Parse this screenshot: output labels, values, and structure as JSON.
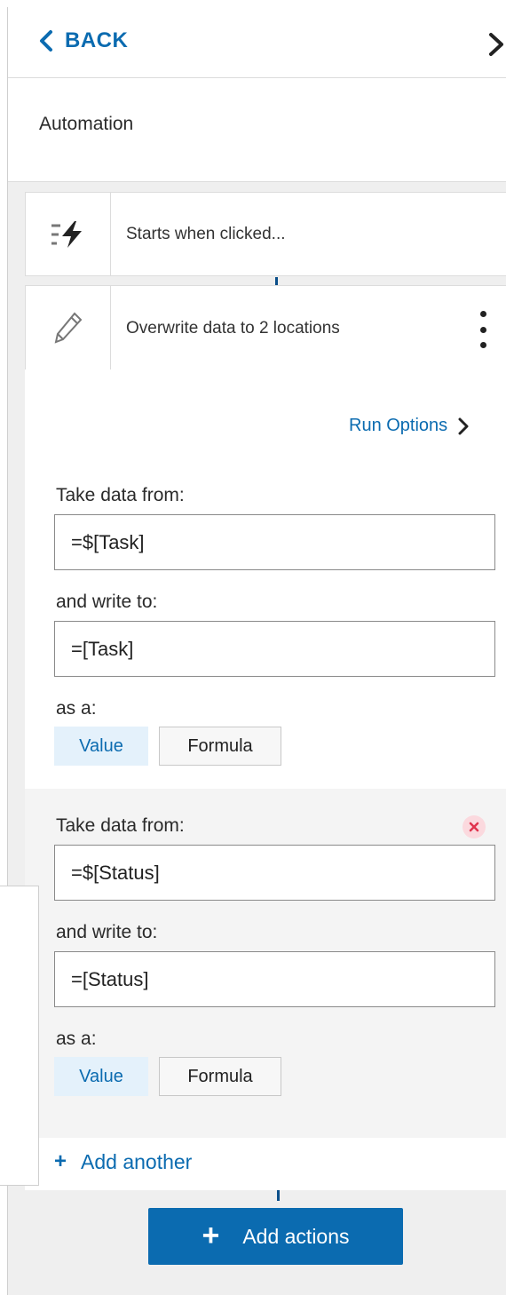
{
  "header": {
    "back_label": "BACK"
  },
  "automation": {
    "title": "Automation"
  },
  "trigger": {
    "label": "Starts when clicked..."
  },
  "action": {
    "label": "Overwrite data to 2 locations"
  },
  "run_options": {
    "label": "Run Options"
  },
  "mappings": [
    {
      "take_label": "Take data from:",
      "take_value": "=$[Task]",
      "write_label": "and write to:",
      "write_value": "=[Task]",
      "as_label": "as a:",
      "value_label": "Value",
      "formula_label": "Formula"
    },
    {
      "take_label": "Take data from:",
      "take_value": "=$[Status]",
      "write_label": "and write to:",
      "write_value": "=[Status]",
      "as_label": "as a:",
      "value_label": "Value",
      "formula_label": "Formula"
    }
  ],
  "add_another": {
    "label": "Add another"
  },
  "add_actions": {
    "label": "Add actions"
  },
  "colors": {
    "accent": "#0b6bb0",
    "remove": "#e0334d"
  }
}
